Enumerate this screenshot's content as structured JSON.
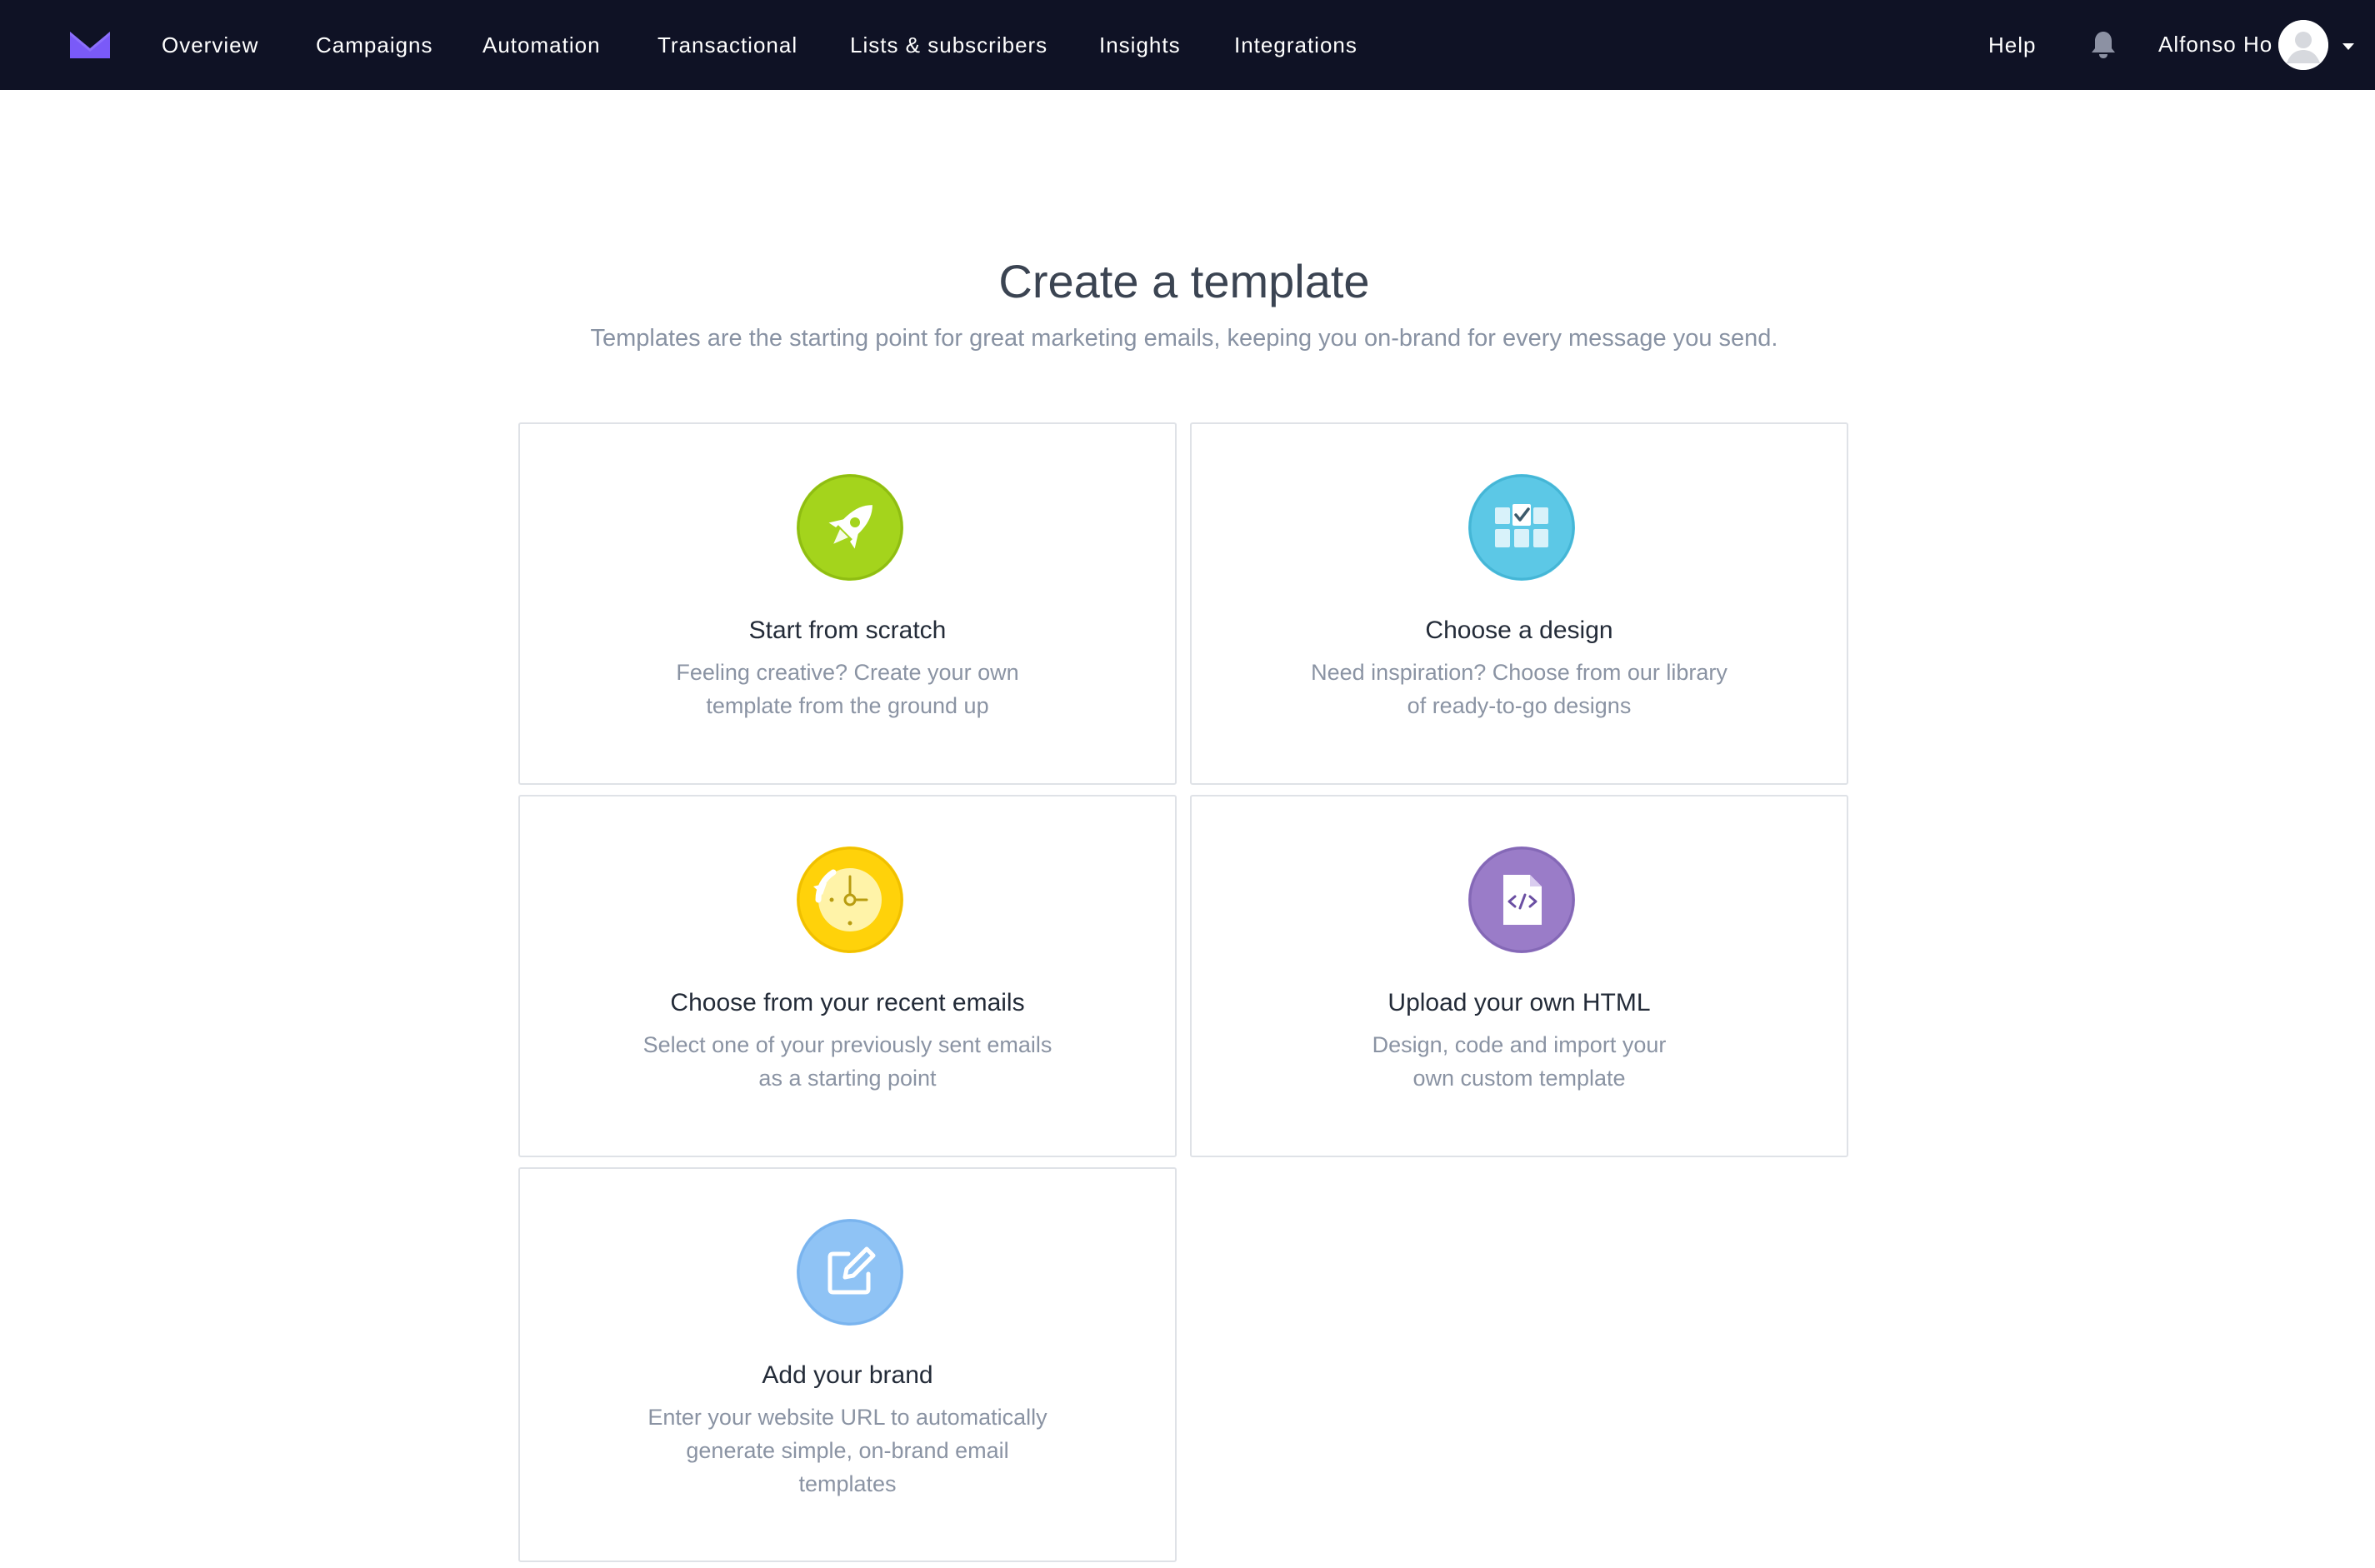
{
  "nav": {
    "items": [
      "Overview",
      "Campaigns",
      "Automation",
      "Transactional",
      "Lists & subscribers",
      "Insights",
      "Integrations"
    ],
    "help": "Help",
    "user_name": "Alfonso Ho",
    "icons": {
      "logo": "envelope-logo-icon",
      "notifications": "bell-icon",
      "avatar": "user-avatar-icon",
      "menu": "caret-down-icon"
    },
    "colors": {
      "background": "#0f1225",
      "logo": "#7a5af8"
    }
  },
  "header": {
    "title": "Create a template",
    "subtitle": "Templates are the starting point for great marketing emails, keeping you on-brand for every message you send."
  },
  "cards": [
    {
      "title": "Start from scratch",
      "desc": [
        "Feeling creative? Create your own",
        "template from the ground up"
      ],
      "icon": "rocket-icon",
      "color": "#a4d41c"
    },
    {
      "title": "Choose a design",
      "desc": [
        "Need inspiration? Choose from our library",
        "of ready-to-go designs"
      ],
      "icon": "design-grid-icon",
      "color": "#5cc8e6"
    },
    {
      "title": "Choose from your recent emails",
      "desc": [
        "Select one of your previously sent emails",
        "as a starting point"
      ],
      "icon": "history-clock-icon",
      "color": "#ffd20a"
    },
    {
      "title": "Upload your own HTML",
      "desc": [
        "Design, code and import your",
        "own custom template"
      ],
      "icon": "html-file-icon",
      "color": "#9a7cc8"
    },
    {
      "title": "Add your brand",
      "desc": [
        "Enter your website URL to automatically",
        "generate simple, on-brand email",
        "templates"
      ],
      "icon": "edit-brand-icon",
      "color": "#8fc3f5"
    }
  ]
}
